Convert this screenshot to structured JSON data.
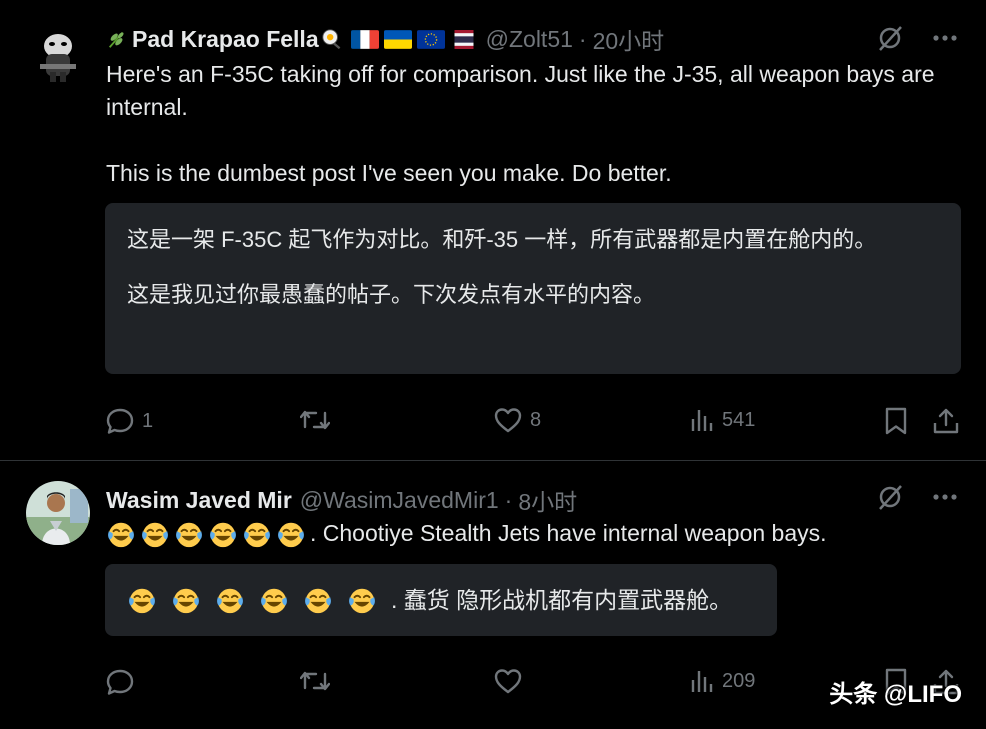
{
  "posts": [
    {
      "author": "Pad Krapao Fella",
      "handle": "@Zolt51",
      "time": "20小时",
      "flags": [
        "france",
        "ukraine",
        "eu",
        "thailand"
      ],
      "text_lines": [
        "Here's an F-35C taking off for comparison. Just like the J-35, all weapon bays are internal.",
        "This is the dumbest post I've seen you make. Do better."
      ],
      "translation_lines": [
        "这是一架 F-35C 起飞作为对比。和歼-35 一样，所有武器都是内置在舱内的。",
        "这是我见过你最愚蠢的帖子。下次发点有水平的内容。"
      ],
      "stats": {
        "replies": "1",
        "reposts": "",
        "likes": "8",
        "views": "541"
      }
    },
    {
      "author": "Wasim Javed Mir",
      "handle": "@WasimJavedMir1",
      "time": "8小时",
      "laugh_count": 6,
      "text_suffix": ". Chootiye Stealth Jets have internal weapon bays.",
      "translation_suffix": ". 蠢货 隐形战机都有内置武器舱。",
      "stats": {
        "replies": "",
        "reposts": "",
        "likes": "",
        "views": "209"
      }
    }
  ],
  "dot_separator": "·",
  "watermark": "头条 @LIFO",
  "icons": [
    "grok-icon",
    "more-icon",
    "reply-icon",
    "repost-icon",
    "like-icon",
    "views-icon",
    "bookmark-icon",
    "share-icon",
    "herb-emoji-icon",
    "egg-pan-emoji-icon",
    "laugh-cry-emoji-icon"
  ]
}
